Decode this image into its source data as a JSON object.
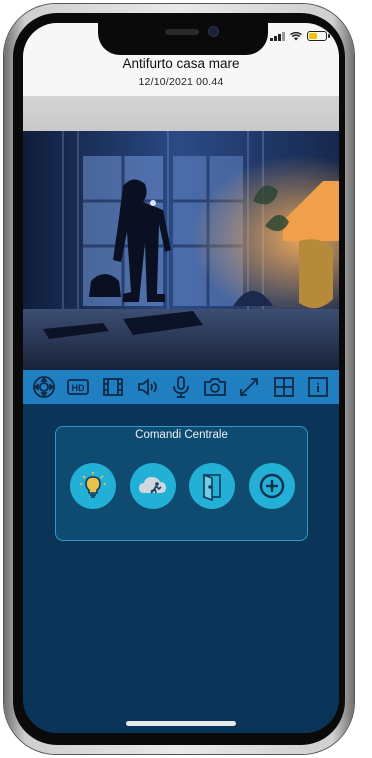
{
  "app": {
    "title": "Antifurto casa mare",
    "datetime": "12/10/2021  00.44"
  },
  "toolbar": {
    "buttons": [
      {
        "icon": "ptz-control-icon"
      },
      {
        "icon": "hd-icon",
        "label": "HD"
      },
      {
        "icon": "film-icon"
      },
      {
        "icon": "speaker-icon"
      },
      {
        "icon": "microphone-icon"
      },
      {
        "icon": "camera-icon"
      },
      {
        "icon": "fullscreen-icon"
      },
      {
        "icon": "grid-icon"
      },
      {
        "icon": "info-icon",
        "label": "i"
      }
    ]
  },
  "panel": {
    "title": "Comandi Centrale",
    "commands": [
      {
        "icon": "light-bulb-icon"
      },
      {
        "icon": "cloud-intruder-icon"
      },
      {
        "icon": "door-icon"
      },
      {
        "icon": "add-icon"
      }
    ]
  },
  "colors": {
    "toolbar": "#1f7fc1",
    "background": "#0b3558",
    "panel_border": "#2c9ac9",
    "command_button": "#23b0d6"
  }
}
